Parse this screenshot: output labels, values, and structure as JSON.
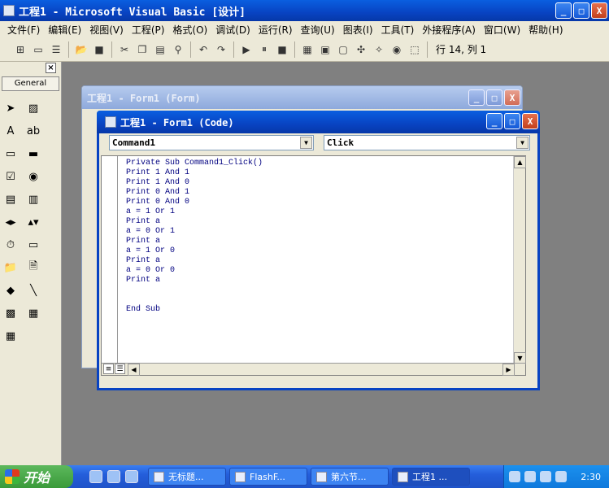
{
  "app": {
    "title": "工程1 - Microsoft Visual Basic [设计]",
    "controls": {
      "minimize": "_",
      "maximize": "□",
      "close": "X"
    }
  },
  "menu": [
    "文件(F)",
    "编辑(E)",
    "视图(V)",
    "工程(P)",
    "格式(O)",
    "调试(D)",
    "运行(R)",
    "查询(U)",
    "图表(I)",
    "工具(T)",
    "外接程序(A)",
    "窗口(W)",
    "帮助(H)"
  ],
  "toolbar": {
    "position": "行 14, 列 1"
  },
  "toolbox": {
    "tab": "General",
    "close": "×"
  },
  "form_window": {
    "title": "工程1 - Form1 (Form)"
  },
  "code_window": {
    "title": "工程1 - Form1 (Code)",
    "object_combo": "Command1",
    "proc_combo": "Click",
    "code": "Private Sub Command1_Click()\nPrint 1 And 1\nPrint 1 And 0\nPrint 0 And 1\nPrint 0 And 0\na = 1 Or 1\nPrint a\na = 0 Or 1\nPrint a\na = 1 Or 0\nPrint a\na = 0 Or 0\nPrint a\n\n\nEnd Sub"
  },
  "taskbar": {
    "start": "开始",
    "tasks": [
      "无标题...",
      "FlashF...",
      "第六节...",
      "工程1 ..."
    ],
    "clock": "2:30"
  }
}
